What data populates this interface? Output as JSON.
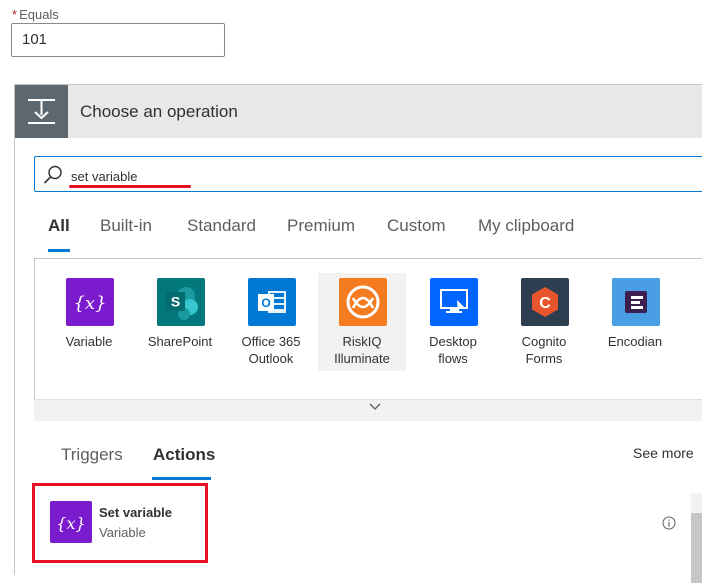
{
  "field": {
    "required_mark": "*",
    "label": "Equals",
    "value": "101"
  },
  "header": {
    "title": "Choose an operation"
  },
  "search": {
    "value": "set variable"
  },
  "tabs": [
    {
      "label": "All"
    },
    {
      "label": "Built-in"
    },
    {
      "label": "Standard"
    },
    {
      "label": "Premium"
    },
    {
      "label": "Custom"
    },
    {
      "label": "My clipboard"
    }
  ],
  "connectors": [
    {
      "line1": "Variable",
      "line2": "",
      "color": "#7a1bcd",
      "icon": "variable-icon"
    },
    {
      "line1": "SharePoint",
      "line2": "",
      "color": "#03787c",
      "icon": "sharepoint-icon"
    },
    {
      "line1": "Office 365",
      "line2": "Outlook",
      "color": "#0078d4",
      "icon": "outlook-icon"
    },
    {
      "line1": "RiskIQ",
      "line2": "Illuminate",
      "color": "#f47b20",
      "icon": "riskiq-icon"
    },
    {
      "line1": "Desktop",
      "line2": "flows",
      "color": "#0066ff",
      "icon": "desktop-flows-icon"
    },
    {
      "line1": "Cognito",
      "line2": "Forms",
      "color": "#2d3e50",
      "icon": "cognito-forms-icon"
    },
    {
      "line1": "Encodian",
      "line2": "",
      "color": "#4a9ee3",
      "icon": "encodian-icon"
    }
  ],
  "sub_tabs": [
    {
      "label": "Triggers"
    },
    {
      "label": "Actions"
    }
  ],
  "see_more": "See more",
  "action": {
    "title": "Set variable",
    "subtitle": "Variable",
    "color": "#7a1bcd"
  }
}
